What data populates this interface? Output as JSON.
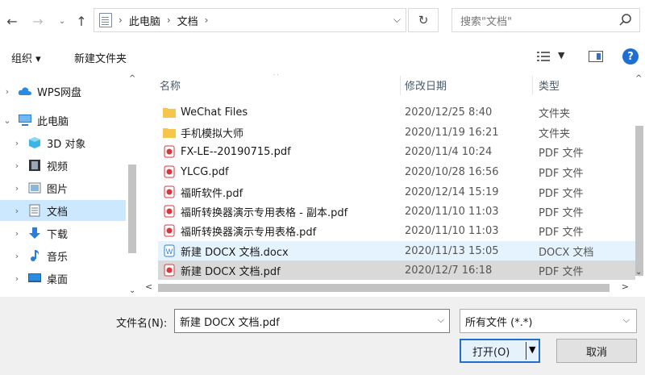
{
  "address": {
    "crumbs": [
      "此电脑",
      "文档"
    ],
    "search_placeholder": "搜索\"文档\""
  },
  "toolbar": {
    "organize_label": "组织 ▾",
    "new_folder_label": "新建文件夹"
  },
  "nav": {
    "items": [
      {
        "label": "WPS网盘",
        "icon": "cloud-icon"
      },
      {
        "label": "此电脑",
        "icon": "computer-icon"
      },
      {
        "label": "3D 对象",
        "icon": "3d-objects-icon"
      },
      {
        "label": "视频",
        "icon": "video-icon"
      },
      {
        "label": "图片",
        "icon": "pictures-icon"
      },
      {
        "label": "文档",
        "icon": "documents-icon"
      },
      {
        "label": "下载",
        "icon": "download-icon"
      },
      {
        "label": "音乐",
        "icon": "music-icon"
      },
      {
        "label": "桌面",
        "icon": "desktop-icon"
      }
    ]
  },
  "list": {
    "columns": {
      "name": "名称",
      "date": "修改日期",
      "type": "类型"
    },
    "rows": [
      {
        "name": "WeChat Files",
        "date": "2020/12/25 8:40",
        "type": "文件夹",
        "icon": "folder-icon"
      },
      {
        "name": "手机模拟大师",
        "date": "2020/11/19 16:21",
        "type": "文件夹",
        "icon": "folder-icon"
      },
      {
        "name": "FX-LE--20190715.pdf",
        "date": "2020/11/4 10:24",
        "type": "PDF 文件",
        "icon": "pdf-icon"
      },
      {
        "name": "YLCG.pdf",
        "date": "2020/10/28 16:56",
        "type": "PDF 文件",
        "icon": "pdf-icon"
      },
      {
        "name": "福昕软件.pdf",
        "date": "2020/12/14 15:19",
        "type": "PDF 文件",
        "icon": "pdf-icon"
      },
      {
        "name": "福昕转换器演示专用表格 - 副本.pdf",
        "date": "2020/11/10 11:03",
        "type": "PDF 文件",
        "icon": "pdf-icon"
      },
      {
        "name": "福昕转换器演示专用表格.pdf",
        "date": "2020/11/10 11:03",
        "type": "PDF 文件",
        "icon": "pdf-icon"
      },
      {
        "name": "新建 DOCX 文档.docx",
        "date": "2020/11/13 15:05",
        "type": "DOCX 文档",
        "icon": "docx-icon"
      },
      {
        "name": "新建 DOCX 文档.pdf",
        "date": "2020/12/7 16:18",
        "type": "PDF 文件",
        "icon": "pdf-icon"
      }
    ]
  },
  "bottom": {
    "filename_label": "文件名(N):",
    "filename_value": "新建 DOCX 文档.pdf",
    "filetype_value": "所有文件 (*.*)",
    "open_label": "打开(O)",
    "cancel_label": "取消"
  },
  "colors": {
    "accent": "#1f6fd1",
    "selection": "#cce8ff",
    "pdf": "#d9363e",
    "folder": "#f5c54c"
  }
}
